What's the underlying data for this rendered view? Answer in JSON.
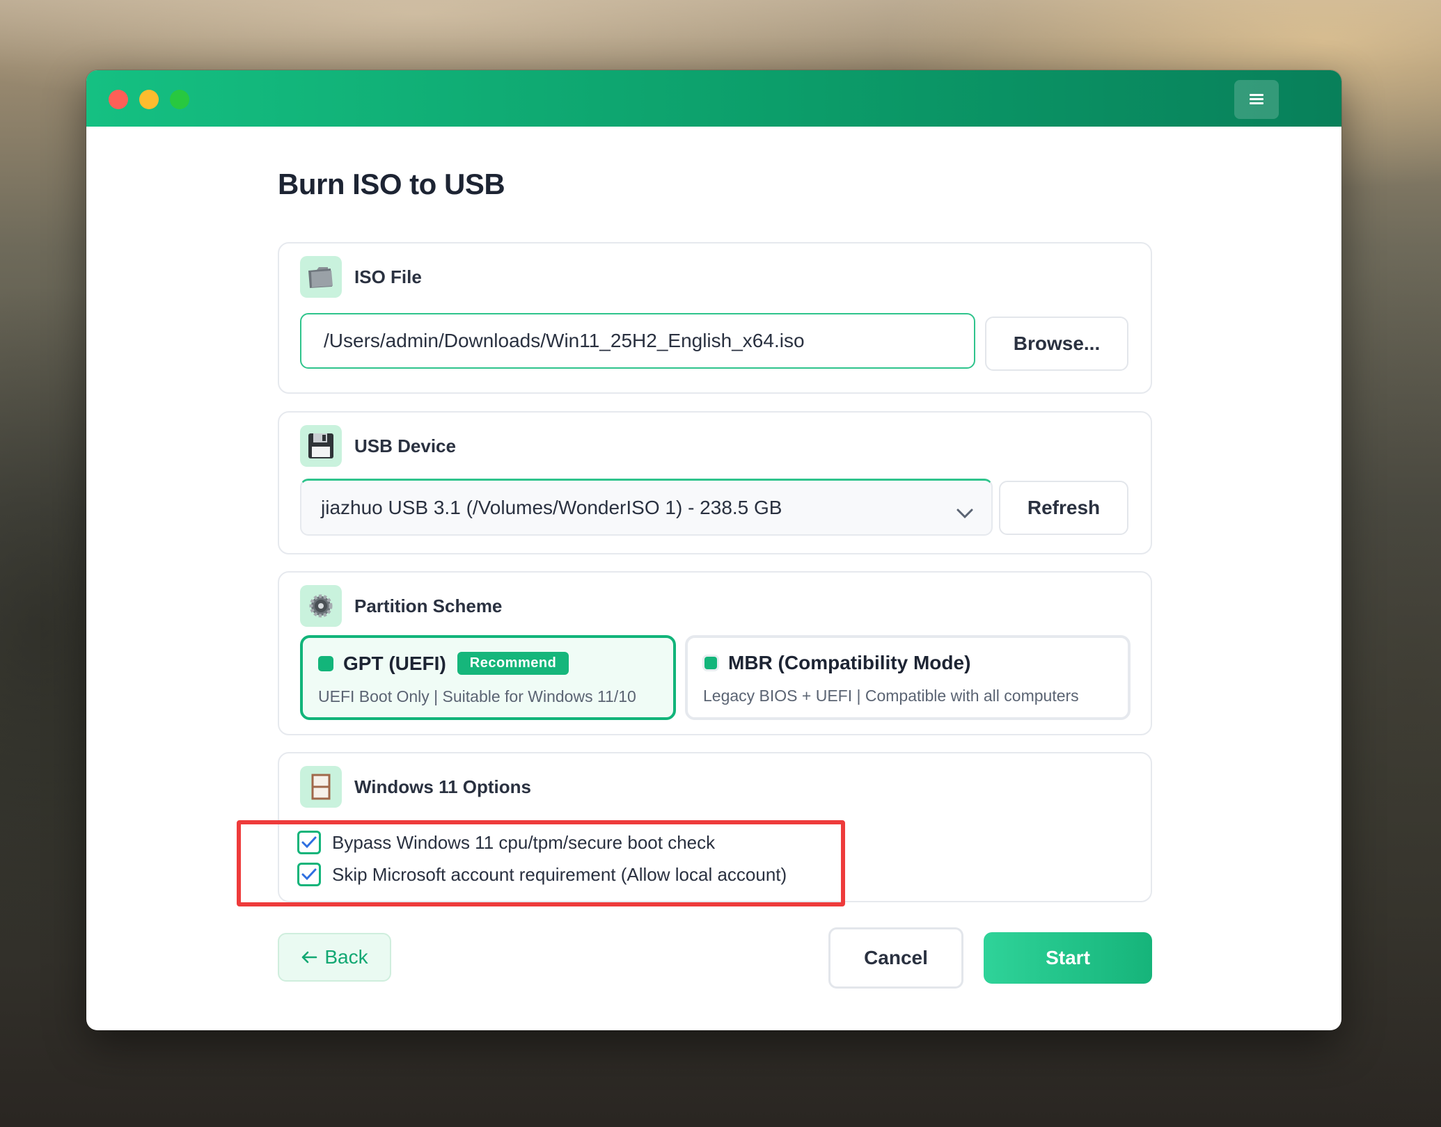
{
  "window": {
    "title": "Burn ISO to USB"
  },
  "iso": {
    "title": "ISO File",
    "path": "/Users/admin/Downloads/Win11_25H2_English_x64.iso",
    "browse_label": "Browse..."
  },
  "usb": {
    "title": "USB Device",
    "selected": "jiazhuo USB 3.1 (/Volumes/WonderISO 1) - 238.5 GB",
    "refresh_label": "Refresh"
  },
  "partition": {
    "title": "Partition Scheme",
    "options": [
      {
        "title": "GPT (UEFI)",
        "badge": "Recommend",
        "desc": "UEFI Boot Only | Suitable for Windows 11/10",
        "selected": true
      },
      {
        "title": "MBR (Compatibility Mode)",
        "desc": "Legacy BIOS + UEFI | Compatible with all computers",
        "selected": false
      }
    ]
  },
  "win11": {
    "title": "Windows 11 Options",
    "options": [
      {
        "label": "Bypass Windows 11 cpu/tpm/secure boot check",
        "checked": true
      },
      {
        "label": "Skip Microsoft account requirement (Allow local account)",
        "checked": true
      }
    ]
  },
  "footer": {
    "back_label": "Back",
    "cancel_label": "Cancel",
    "start_label": "Start"
  },
  "colors": {
    "accent": "#12b47a",
    "titlebar": "#0c9e6a",
    "highlight": "#ee3b3b"
  },
  "icons": {
    "iso": "folder-icon",
    "usb": "floppy-disk-icon",
    "partition": "gear-icon",
    "win11": "window-icon",
    "menu": "hamburger-menu-icon"
  }
}
